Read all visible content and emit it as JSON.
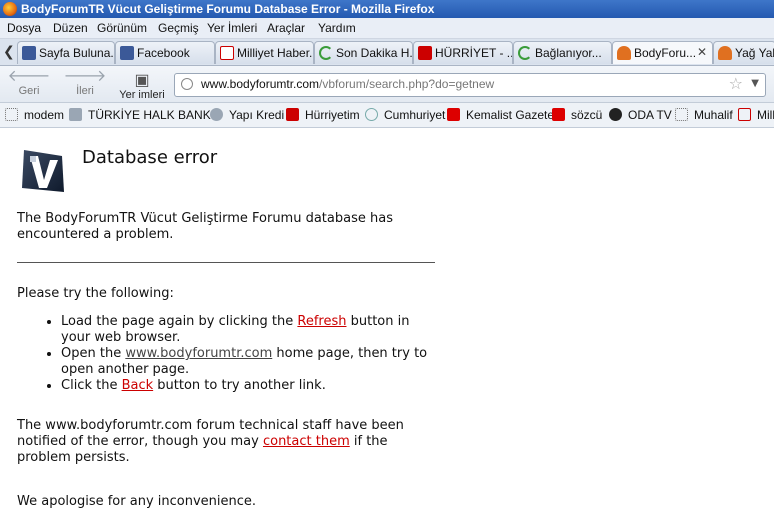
{
  "window": {
    "title": "BodyForumTR Vücut Geliştirme Forumu Database Error - Mozilla Firefox"
  },
  "menu": [
    "Dosya",
    "Düzen",
    "Görünüm",
    "Geçmiş",
    "Yer İmleri",
    "Araçlar",
    "Yardım"
  ],
  "tabs": [
    {
      "label": "Sayfa Buluna...",
      "icon": "facebook-icon"
    },
    {
      "label": "Facebook",
      "icon": "facebook-icon"
    },
    {
      "label": "Milliyet Haber...",
      "icon": "milliyet-icon"
    },
    {
      "label": "Son Dakika H...",
      "icon": "loading-icon"
    },
    {
      "label": "HÜRRİYET - ...",
      "icon": "hurriyet-icon"
    },
    {
      "label": "Bağlanıyor...",
      "icon": "loading-icon"
    },
    {
      "label": "BodyForu...",
      "icon": "bodyforum-icon",
      "active": true
    },
    {
      "label": "Yağ Yakı",
      "icon": "bodyforum-icon"
    }
  ],
  "nav": {
    "back": "Geri",
    "forward": "İleri",
    "bookmarks": "Yer imleri"
  },
  "address": {
    "domain": "www.bodyforumtr.com",
    "path": "/vbforum/search.php?do=getnew"
  },
  "bookmarks": [
    "modem",
    "TÜRKİYE HALK BANK...",
    "Yapı Kredi",
    "Hürriyetim",
    "Cumhuriyet",
    "Kemalist Gazete",
    "sözcü",
    "ODA TV",
    "Muhalif",
    "Milli"
  ],
  "page": {
    "heading": "Database error",
    "intro": "The BodyForumTR Vücut Geliştirme Forumu database has encountered a problem.",
    "try_following": "Please try the following:",
    "opt1_pre": "Load the page again by clicking the ",
    "opt1_link": "Refresh",
    "opt1_post": " button in your web browser.",
    "opt2_pre": "Open the ",
    "opt2_link": "www.bodyforumtr.com",
    "opt2_post": " home page, then try to open another page.",
    "opt3_pre": "Click the ",
    "opt3_link": "Back",
    "opt3_post": " button to try another link.",
    "staff_pre": "The www.bodyforumtr.com forum technical staff have been notified of the error, though you may ",
    "staff_link": "contact them",
    "staff_post": " if the problem persists.",
    "apology": "We apologise for any inconvenience."
  }
}
